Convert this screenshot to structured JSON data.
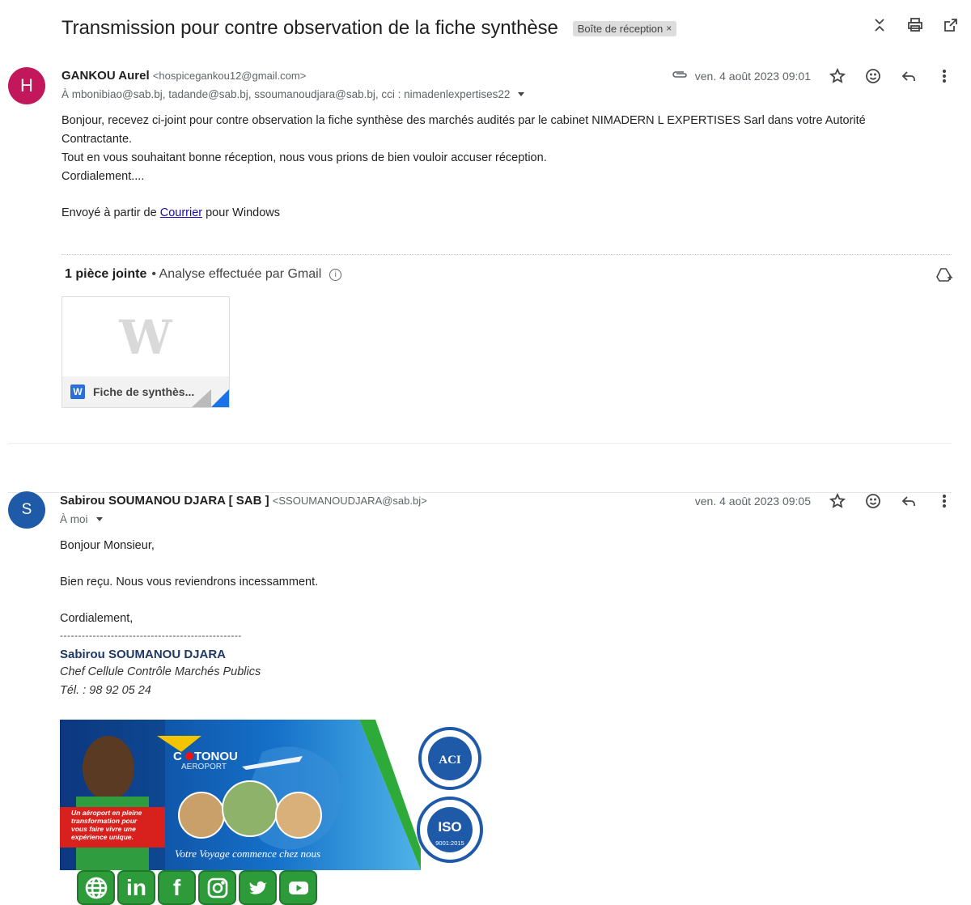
{
  "thread": {
    "subject": "Transmission pour contre observation de la fiche synthèse",
    "label": "Boîte de réception",
    "label_close": "×"
  },
  "message1": {
    "avatar_letter": "H",
    "sender_name": "GANKOU Aurel",
    "sender_email": "<hospicegankou12@gmail.com>",
    "recipients": "À mbonibiao@sab.bj, tadande@sab.bj, ssoumanoudjara@sab.bj, cci : nimadenlexpertises22",
    "date": "ven. 4 août 2023 09:01",
    "body": [
      "Bonjour, recevez ci-joint pour contre observation la fiche synthèse des marchés audités par le cabinet NIMADERN L EXPERTISES Sarl  dans votre Autorité",
      "Contractante.",
      "Tout en vous souhaitant bonne réception, nous vous prions de bien vouloir accuser réception.",
      "Cordialement...."
    ],
    "sent_from_prefix": "Envoyé à partir de ",
    "sent_from_link": "Courrier",
    "sent_from_suffix": " pour Windows",
    "attachments_count_label": "1 pièce jointe",
    "scan_label": "• Analyse effectuée par Gmail",
    "attachment": {
      "preview_letter": "W",
      "badge": "W",
      "name": "Fiche de synthès..."
    }
  },
  "message2": {
    "avatar_letter": "S",
    "sender_name": "Sabirou SOUMANOU DJARA [ SAB ]",
    "sender_email": "<SSOUMANOUDJARA@sab.bj>",
    "recipients": "À moi",
    "date": "ven. 4 août 2023 09:05",
    "greeting": "Bonjour Monsieur,",
    "line1": "Bien reçu. Nous vous reviendrons incessamment.",
    "closing": "Cordialement,",
    "dashes": "--------------------------------------------------",
    "sig_name": "Sabirou SOUMANOU DJARA",
    "sig_title": "Chef Cellule Contrôle Marchés Publics",
    "sig_phone": "Tél. : 98 92 05 24"
  },
  "banner": {
    "brand_c": "C",
    "brand_rest": "TONOU",
    "brand_sub": "AEROPORT",
    "tagline_1": "Un aéroport en pleine",
    "tagline_2": "transformation pour",
    "tagline_3": "vous faire vivre une",
    "tagline_4": "expérience unique.",
    "slogan": "Votre Voyage commence chez nous",
    "iso_text": "ISO",
    "iso_num": "9001:2015",
    "aci_text": "ACI"
  },
  "social": {
    "li": "in",
    "fb": "f"
  },
  "colors": {
    "accent": "#1a73e8",
    "avatar1": "#c2185b",
    "avatar2": "#1e5aa8",
    "social_green": "#2e9b3a"
  }
}
